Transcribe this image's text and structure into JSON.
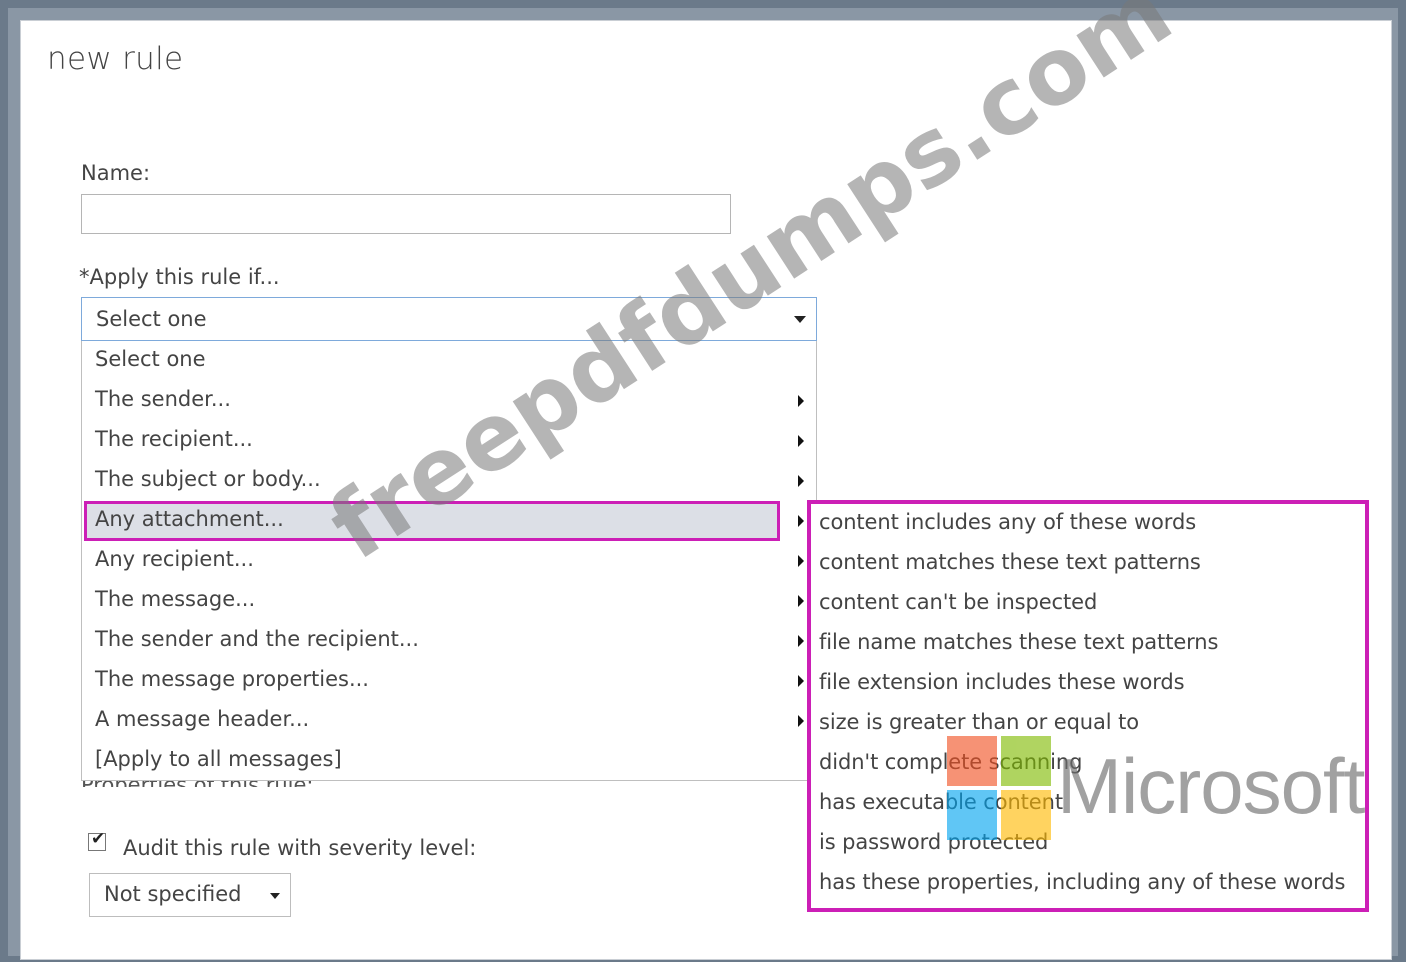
{
  "dialog": {
    "title": "new rule",
    "name_label": "Name:",
    "name_value": "",
    "apply_label": "*Apply this rule if...",
    "apply_select_value": "Select one",
    "dropdown_items": [
      {
        "label": "Select one",
        "has_submenu": false
      },
      {
        "label": "The sender...",
        "has_submenu": true
      },
      {
        "label": "The recipient...",
        "has_submenu": true
      },
      {
        "label": "The subject or body...",
        "has_submenu": true
      },
      {
        "label": "Any attachment...",
        "has_submenu": true,
        "highlighted": true
      },
      {
        "label": "Any recipient...",
        "has_submenu": true
      },
      {
        "label": "The message...",
        "has_submenu": true
      },
      {
        "label": "The sender and the recipient...",
        "has_submenu": true
      },
      {
        "label": "The message properties...",
        "has_submenu": true
      },
      {
        "label": "A message header...",
        "has_submenu": true
      },
      {
        "label": "[Apply to all messages]",
        "has_submenu": false
      }
    ],
    "properties_label": "Properties of this rule:",
    "audit_checked": true,
    "audit_label": "Audit this rule with severity level:",
    "severity_value": "Not specified"
  },
  "submenu": {
    "items": [
      "content includes any of these words",
      "content matches these text patterns",
      "content can't be inspected",
      "file name matches these text patterns",
      "file extension includes these words",
      "size is greater than or equal to",
      "didn't complete scanning",
      "has executable content",
      "is password protected",
      "has these properties, including any of these words"
    ]
  },
  "watermark": {
    "text": "freepdfdumps.com",
    "brand": "Microsoft",
    "logo_colors": [
      "#f25022",
      "#7fba00",
      "#00a4ef",
      "#ffb900"
    ]
  },
  "colors": {
    "highlight_border": "#cc1fb6",
    "selected_bg": "#dcdfe6",
    "focus_border": "#7eaadb"
  }
}
